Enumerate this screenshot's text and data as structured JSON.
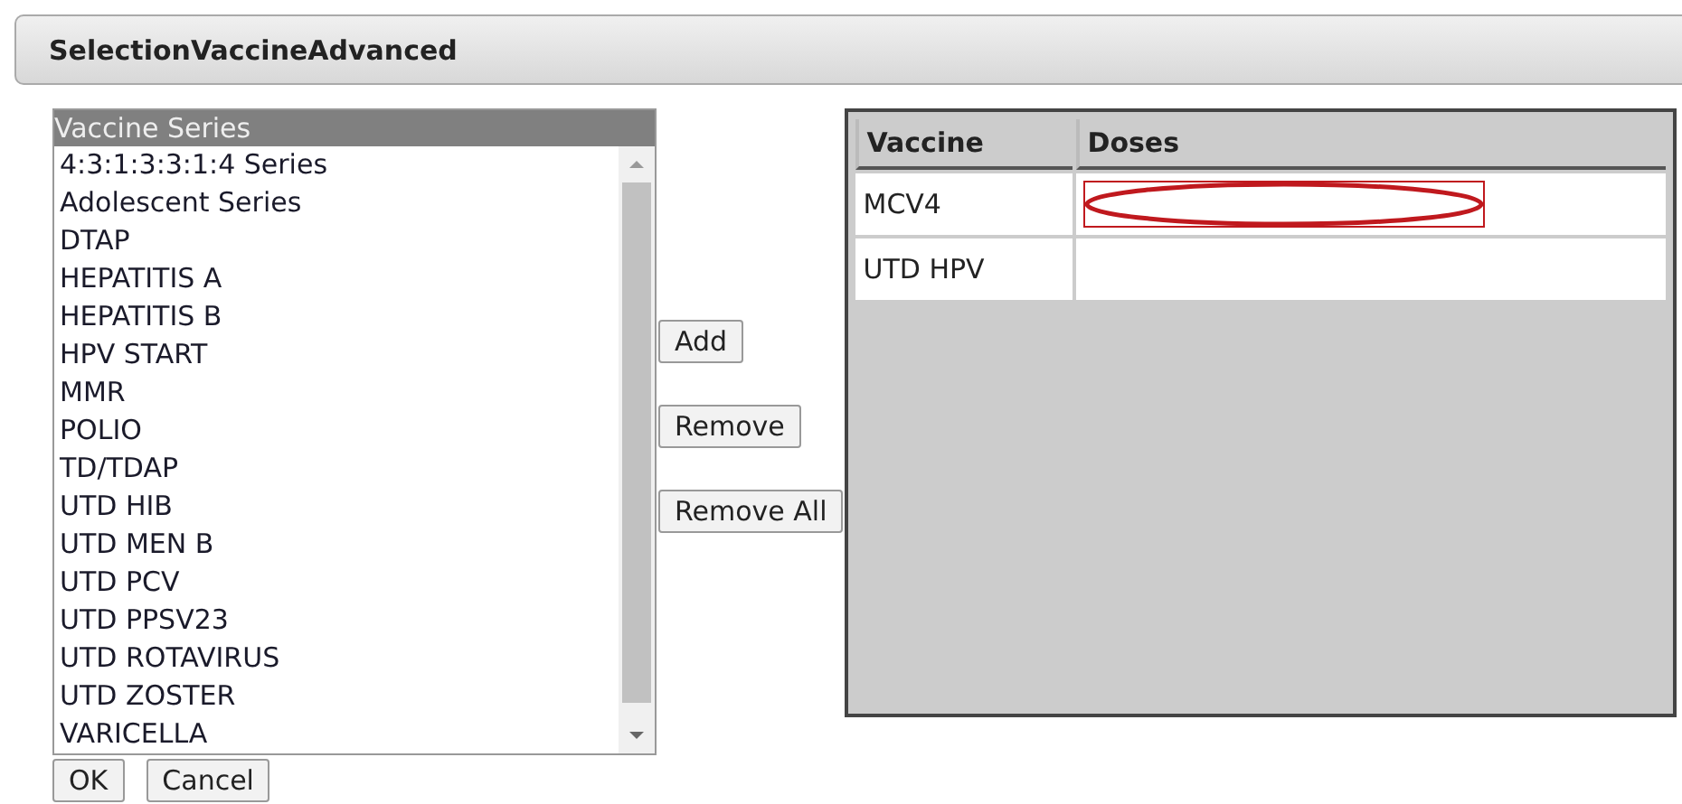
{
  "window": {
    "title": "SelectionVaccineAdvanced"
  },
  "series_list": {
    "header": "Vaccine Series",
    "items": [
      {
        "label": "4:3:1:3:3:1:4 Series",
        "selected": false
      },
      {
        "label": "Adolescent Series",
        "selected": false
      },
      {
        "label": "DTAP",
        "selected": false
      },
      {
        "label": "HEPATITIS A",
        "selected": false
      },
      {
        "label": "HEPATITIS B",
        "selected": false
      },
      {
        "label": "HPV START",
        "selected": false
      },
      {
        "label": "MMR",
        "selected": false
      },
      {
        "label": "POLIO",
        "selected": false
      },
      {
        "label": "TD/TDAP",
        "selected": false
      },
      {
        "label": "UTD HIB",
        "selected": false
      },
      {
        "label": "UTD MEN B",
        "selected": false
      },
      {
        "label": "UTD PCV",
        "selected": false
      },
      {
        "label": "UTD PPSV23",
        "selected": false
      },
      {
        "label": "UTD ROTAVIRUS",
        "selected": false
      },
      {
        "label": "UTD ZOSTER",
        "selected": false
      },
      {
        "label": "VARICELLA",
        "selected": false
      }
    ]
  },
  "move_buttons": [
    "Add",
    "Remove",
    "Remove All"
  ],
  "table": {
    "columns": [
      "Vaccine",
      "Doses"
    ],
    "rows": [
      {
        "vaccine": "MCV4",
        "has_field": true,
        "highlighted": true
      },
      {
        "vaccine": "UTD HPV",
        "has_field": false,
        "highlighted": false
      }
    ]
  },
  "buttons": [
    "OK",
    "Cancel"
  ]
}
